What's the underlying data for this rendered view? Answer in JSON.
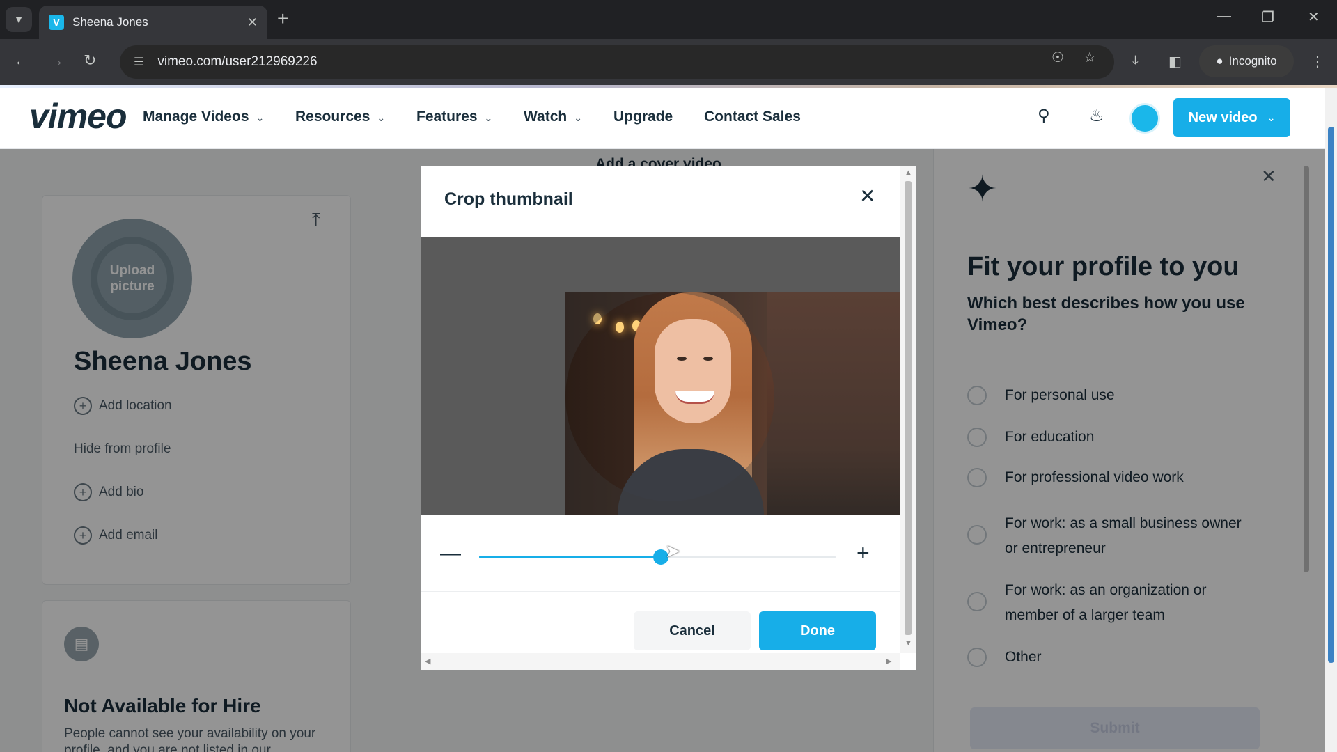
{
  "browser": {
    "tab_title": "Sheena Jones",
    "favicon_letter": "V",
    "url": "vimeo.com/user212969226",
    "incognito_label": "Incognito"
  },
  "nav": {
    "logo": "vimeo",
    "menu": [
      {
        "label": "Manage Videos",
        "has_dropdown": true
      },
      {
        "label": "Resources",
        "has_dropdown": true
      },
      {
        "label": "Features",
        "has_dropdown": true
      },
      {
        "label": "Watch",
        "has_dropdown": true
      },
      {
        "label": "Upgrade",
        "has_dropdown": false
      },
      {
        "label": "Contact Sales",
        "has_dropdown": false
      }
    ],
    "new_video_label": "New video"
  },
  "profile": {
    "upload_picture": "Upload picture",
    "name": "Sheena Jones",
    "add_location": "Add location",
    "hide_from_profile": "Hide from profile",
    "add_bio": "Add bio",
    "add_email": "Add email",
    "hire_title": "Not Available for Hire",
    "hire_desc": "People cannot see your availability on your profile, and you are not listed in our"
  },
  "cover": {
    "title": "Add a cover video"
  },
  "right_panel": {
    "title": "Fit your profile to you",
    "subtitle": "Which best describes how you use Vimeo?",
    "options": [
      "For personal use",
      "For education",
      "For professional video work",
      "For work: as a small business owner or entrepreneur",
      "For work: as an organization or member of a larger team",
      "Other"
    ],
    "submit_label": "Submit"
  },
  "modal": {
    "title": "Crop thumbnail",
    "zoom_level": 0.51,
    "cancel_label": "Cancel",
    "done_label": "Done"
  },
  "colors": {
    "accent": "#17aee8",
    "text_dark": "#1a2e3b"
  }
}
